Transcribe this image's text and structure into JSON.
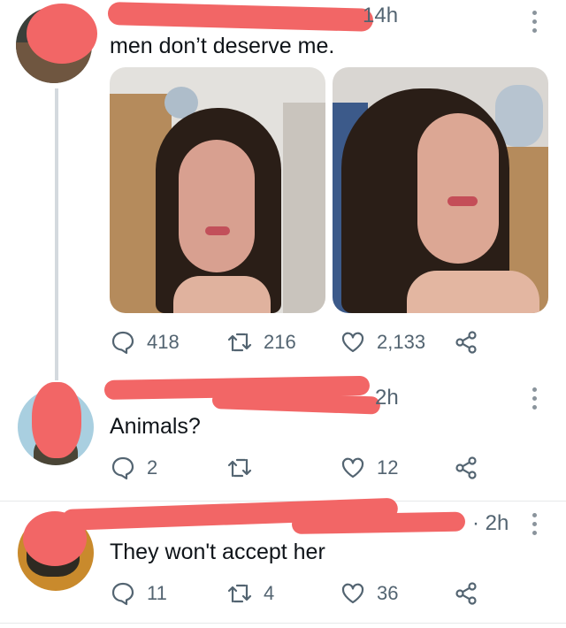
{
  "tweets": [
    {
      "time": "14h",
      "text": "men don’t deserve me.",
      "actions": {
        "replies": "418",
        "retweets": "216",
        "likes": "2,133"
      }
    },
    {
      "time": "2h",
      "text": "Animals?",
      "actions": {
        "replies": "2",
        "retweets": "",
        "likes": "12"
      }
    },
    {
      "time": "· 2h",
      "text": "They won't accept her",
      "actions": {
        "replies": "11",
        "retweets": "4",
        "likes": "36"
      }
    }
  ],
  "icons": [
    "reply-icon",
    "retweet-icon",
    "like-icon",
    "share-icon",
    "more-icon"
  ],
  "colors": {
    "redaction": "#f26666",
    "text": "#0f1419",
    "muted": "#536471",
    "thread_line": "#d4d9de"
  }
}
